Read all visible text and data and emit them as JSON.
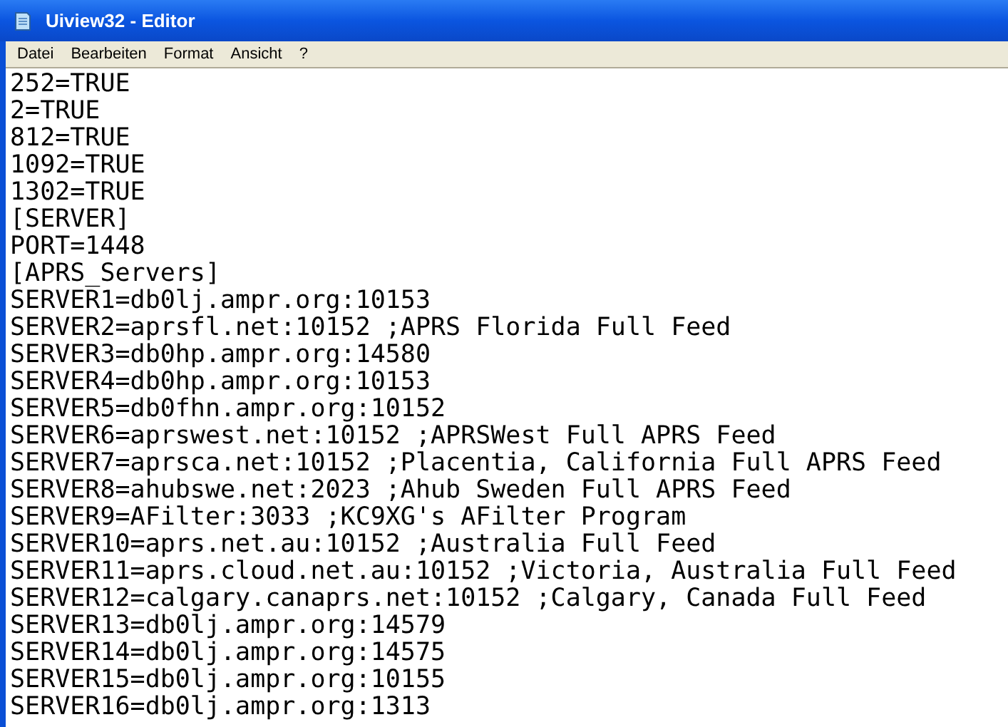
{
  "window": {
    "title": "Uiview32 - Editor"
  },
  "menu": [
    "Datei",
    "Bearbeiten",
    "Format",
    "Ansicht",
    "?"
  ],
  "lines": [
    "252=TRUE",
    "2=TRUE",
    "812=TRUE",
    "1092=TRUE",
    "1302=TRUE",
    "[SERVER]",
    "PORT=1448",
    "[APRS_Servers]",
    "SERVER1=db0lj.ampr.org:10153",
    "SERVER2=aprsfl.net:10152 ;APRS Florida Full Feed",
    "SERVER3=db0hp.ampr.org:14580",
    "SERVER4=db0hp.ampr.org:10153",
    "SERVER5=db0fhn.ampr.org:10152",
    "SERVER6=aprswest.net:10152 ;APRSWest Full APRS Feed",
    "SERVER7=aprsca.net:10152 ;Placentia, California Full APRS Feed",
    "SERVER8=ahubswe.net:2023 ;Ahub Sweden Full APRS Feed",
    "SERVER9=AFilter:3033 ;KC9XG's AFilter Program",
    "SERVER10=aprs.net.au:10152 ;Australia Full Feed",
    "SERVER11=aprs.cloud.net.au:10152 ;Victoria, Australia Full Feed",
    "SERVER12=calgary.canaprs.net:10152 ;Calgary, Canada Full Feed",
    "SERVER13=db0lj.ampr.org:14579",
    "SERVER14=db0lj.ampr.org:14575",
    "SERVER15=db0lj.ampr.org:10155",
    "SERVER16=db0lj.ampr.org:1313"
  ]
}
